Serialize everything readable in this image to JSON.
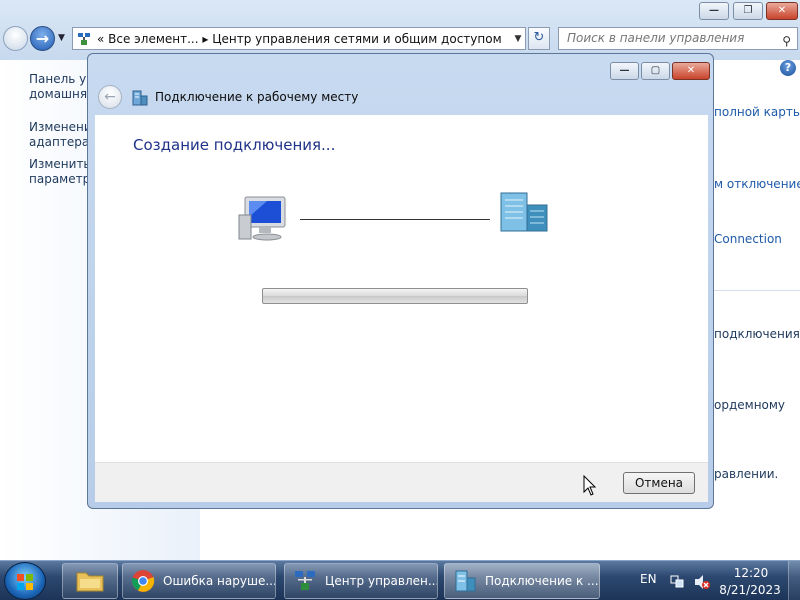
{
  "explorer": {
    "address": "«  Все элемент...  ▸  Центр управления сетями и общим доступом",
    "search_placeholder": "Поиск в панели управления",
    "left_pane": [
      "Панель уп",
      "домашняя",
      "Изменени",
      "адаптера",
      "Изменить",
      "параметры"
    ],
    "right_pane": [
      "полной карты",
      "м отключение",
      "Connection",
      "подключения",
      "ордемному",
      "равлении."
    ]
  },
  "dialog": {
    "title": "Подключение к рабочему месту",
    "heading": "Создание подключения...",
    "cancel_label": "Отмена",
    "progress_fraction": 0.0
  },
  "taskbar": {
    "items": [
      {
        "label": "Ошибка наруше...",
        "icon": "chrome-icon"
      },
      {
        "label": "Центр управлен...",
        "icon": "network-center-icon"
      },
      {
        "label": "Подключение к ...",
        "icon": "workplace-connection-icon"
      }
    ],
    "language": "EN",
    "time": "12:20",
    "date": "8/21/2023"
  },
  "colors": {
    "accent_heading": "#1e3287",
    "link": "#1e5aa8",
    "taskbar": "#2d4870"
  }
}
